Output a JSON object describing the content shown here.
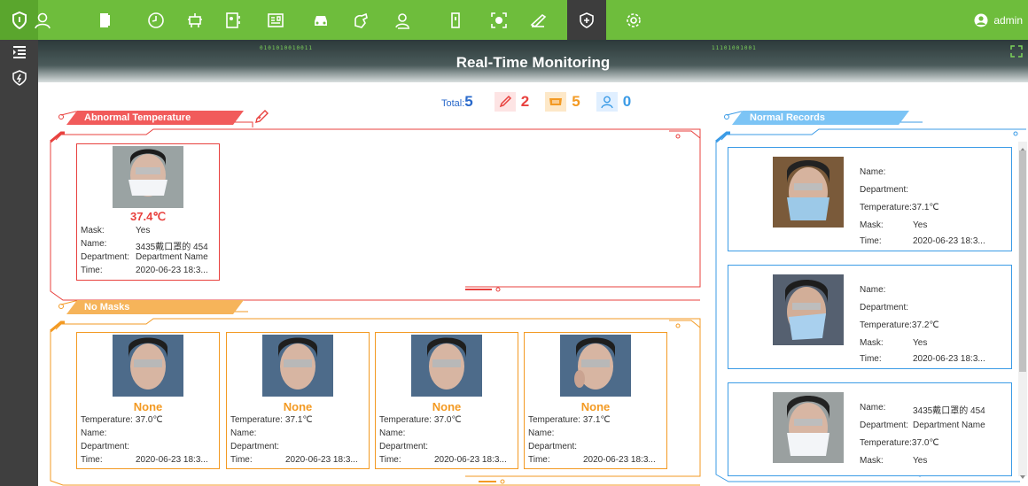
{
  "topbar": {
    "user_name": "admin",
    "nav_icons": [
      "person-icon",
      "door-icon",
      "clock-icon",
      "robot-icon",
      "attendance-icon",
      "id-card-icon",
      "car-icon",
      "hand-icon",
      "visitor-icon",
      "elevator-icon",
      "scan-icon",
      "patrol-icon",
      "shield-plus-icon",
      "settings-icon"
    ]
  },
  "banner": {
    "title": "Real-Time Monitoring",
    "deco_left": "0101010010011",
    "deco_right": "11101001001"
  },
  "stats": {
    "total_label": "Total:",
    "total_value": "5",
    "abnormal_temp_count": "2",
    "no_mask_count": "5",
    "stranger_count": "0"
  },
  "colors": {
    "red": "#e8413e",
    "orange": "#f39a23",
    "blue": "#3b9be6",
    "green": "#6ebd3c"
  },
  "abnormal": {
    "title": "Abnormal Temperature",
    "cards": [
      {
        "value": "37.4℃",
        "mask_label": "Mask:",
        "mask": "Yes",
        "name_label": "Name:",
        "name": "3435戴口罩的 454",
        "dept_label": "Department:",
        "dept": "Department Name",
        "time_label": "Time:",
        "time": "2020-06-23 18:3..."
      }
    ]
  },
  "nomask": {
    "title": "No Masks",
    "cards": [
      {
        "value": "None",
        "temp_label": "Temperature:",
        "temp": "37.0℃",
        "name_label": "Name:",
        "name": "",
        "dept_label": "Department:",
        "dept": "",
        "time_label": "Time:",
        "time": "2020-06-23 18:3..."
      },
      {
        "value": "None",
        "temp_label": "Temperature:",
        "temp": "37.1℃",
        "name_label": "Name:",
        "name": "",
        "dept_label": "Department:",
        "dept": "",
        "time_label": "Time:",
        "time": "2020-06-23 18:3..."
      },
      {
        "value": "None",
        "temp_label": "Temperature:",
        "temp": "37.0℃",
        "name_label": "Name:",
        "name": "",
        "dept_label": "Department:",
        "dept": "",
        "time_label": "Time:",
        "time": "2020-06-23 18:3..."
      },
      {
        "value": "None",
        "temp_label": "Temperature:",
        "temp": "37.1℃",
        "name_label": "Name:",
        "name": "",
        "dept_label": "Department:",
        "dept": "",
        "time_label": "Time:",
        "time": "2020-06-23 18:3..."
      }
    ]
  },
  "normal": {
    "title": "Normal Records",
    "cards": [
      {
        "name_label": "Name:",
        "name": "",
        "dept_label": "Department:",
        "dept": "",
        "temp_label": "Temperature:",
        "temp": "37.1℃",
        "mask_label": "Mask:",
        "mask": "Yes",
        "time_label": "Time:",
        "time": "2020-06-23 18:3..."
      },
      {
        "name_label": "Name:",
        "name": "",
        "dept_label": "Department:",
        "dept": "",
        "temp_label": "Temperature:",
        "temp": "37.2℃",
        "mask_label": "Mask:",
        "mask": "Yes",
        "time_label": "Time:",
        "time": "2020-06-23 18:3..."
      },
      {
        "name_label": "Name:",
        "name": "3435戴口罩的 454",
        "dept_label": "Department:",
        "dept": "Department Name",
        "temp_label": "Temperature:",
        "temp": "37.0℃",
        "mask_label": "Mask:",
        "mask": "Yes"
      }
    ]
  }
}
